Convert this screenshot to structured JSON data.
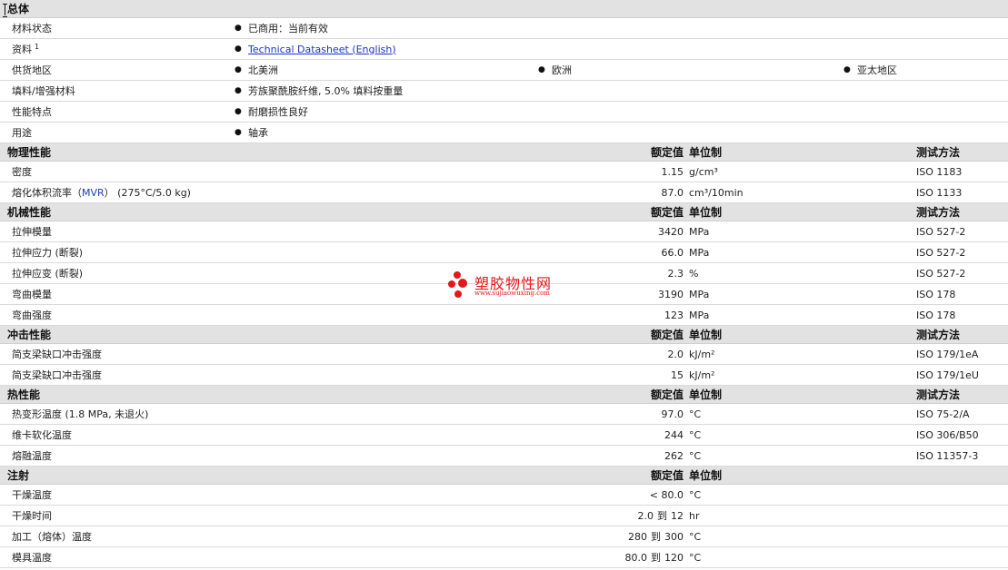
{
  "sections": {
    "general": "总体",
    "physical": "物理性能",
    "mechanical": "机械性能",
    "impact": "冲击性能",
    "thermal": "热性能",
    "injection": "注射"
  },
  "headers": {
    "nominal": "额定值",
    "unit": "单位制",
    "method": "测试方法"
  },
  "general": {
    "status_label": "材料状态",
    "status_value": "已商用：当前有效",
    "docs_label": "资料",
    "docs_sup": "1",
    "docs_link": "Technical Datasheet (English)",
    "supply_label": "供货地区",
    "supply_1": "北美洲",
    "supply_2": "欧洲",
    "supply_3": "亚太地区",
    "filler_label": "填料/增强材料",
    "filler_value": "芳族聚酰胺纤维, 5.0% 填料按重量",
    "feature_label": "性能特点",
    "feature_value": "耐磨损性良好",
    "use_label": "用途",
    "use_value": "轴承",
    "bullet": "●"
  },
  "physical": [
    {
      "label": "密度",
      "value": "1.15",
      "unit": "g/cm³",
      "method": "ISO 1183"
    },
    {
      "label_a": "熔化体积流率（",
      "label_b": "MVR",
      "label_c": "） (275°C/5.0 kg)",
      "value": "87.0",
      "unit": "cm³/10min",
      "method": "ISO 1133"
    }
  ],
  "mechanical": [
    {
      "label": "拉伸模量",
      "value": "3420",
      "unit": "MPa",
      "method": "ISO 527-2"
    },
    {
      "label": "拉伸应力 (断裂)",
      "value": "66.0",
      "unit": "MPa",
      "method": "ISO 527-2"
    },
    {
      "label": "拉伸应变 (断裂)",
      "value": "2.3",
      "unit": "%",
      "method": "ISO 527-2"
    },
    {
      "label": "弯曲模量",
      "value": "3190",
      "unit": "MPa",
      "method": "ISO 178"
    },
    {
      "label": "弯曲强度",
      "value": "123",
      "unit": "MPa",
      "method": "ISO 178"
    }
  ],
  "impact": [
    {
      "label": "简支梁缺口冲击强度",
      "value": "2.0",
      "unit": "kJ/m²",
      "method": "ISO 179/1eA"
    },
    {
      "label": "简支梁缺口冲击强度",
      "value": "15",
      "unit": "kJ/m²",
      "method": "ISO 179/1eU"
    }
  ],
  "thermal": [
    {
      "label": "热变形温度 (1.8 MPa, 未退火)",
      "value": "97.0",
      "unit": "°C",
      "method": "ISO 75-2/A"
    },
    {
      "label": "维卡软化温度",
      "value": "244",
      "unit": "°C",
      "method": "ISO 306/B50"
    },
    {
      "label": "熔融温度",
      "value": "262",
      "unit": "°C",
      "method": "ISO 11357-3"
    }
  ],
  "injection": [
    {
      "label": "干燥温度",
      "value": "< 80.0",
      "unit": "°C"
    },
    {
      "label": "干燥时间",
      "from": "2.0",
      "to": "到",
      "end": "12",
      "unit": "hr"
    },
    {
      "label": "加工（熔体）温度",
      "from": "280",
      "to": "到",
      "end": "300",
      "unit": "°C"
    },
    {
      "label": "模具温度",
      "from": "80.0",
      "to": "到",
      "end": "120",
      "unit": "°C"
    }
  ],
  "watermark": {
    "name": "塑胶物性网",
    "url": "www.sujiaowuxing.com",
    "color": "#e4171b"
  }
}
